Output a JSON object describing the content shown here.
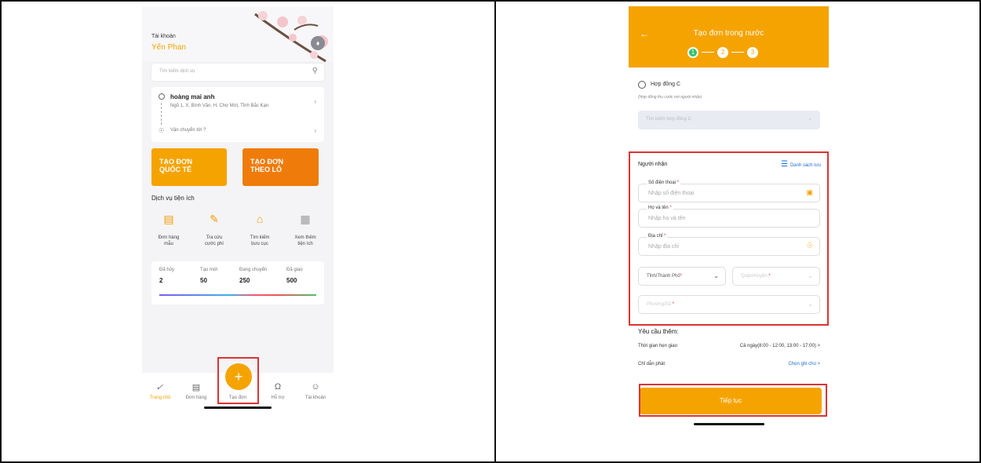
{
  "left": {
    "account": {
      "label": "Tài khoản",
      "name": "Yến Phan"
    },
    "search_placeholder": "Tìm kiếm dịch vụ",
    "address": {
      "sender": "hoàng mai anh",
      "line": "Ngõ 1, X. Bình Văn, H. Chợ Mới, Tỉnh Bắc Kạn",
      "to": "Vận chuyển tới ?"
    },
    "cards": [
      {
        "l1": "TẠO ĐƠN",
        "l2": "QUỐC TẾ"
      },
      {
        "l1": "TẠO ĐƠN",
        "l2": "THEO LÔ"
      }
    ],
    "section_title": "Dịch vụ tiện ích",
    "utilities": [
      {
        "icon": "notebook-icon",
        "l1": "Đơn hàng",
        "l2": "mẫu"
      },
      {
        "icon": "search-fee-icon",
        "l1": "Tra cứu",
        "l2": "cước phí"
      },
      {
        "icon": "post-office-icon",
        "l1": "Tìm kiếm",
        "l2": "bưu cục"
      },
      {
        "icon": "grid-icon",
        "l1": "Xem thêm",
        "l2": "tiện ích"
      }
    ],
    "stats": [
      {
        "k": "Đã hủy",
        "v": "2"
      },
      {
        "k": "Tạo mới",
        "v": "50"
      },
      {
        "k": "Đang chuyển",
        "v": "250"
      },
      {
        "k": "Đã giao",
        "v": "500"
      }
    ],
    "nav": [
      "Trang chủ",
      "Đơn hàng",
      "Tạo đơn",
      "Hỗ trợ",
      "Tài khoản"
    ],
    "fab": "+"
  },
  "right": {
    "title": "Tạo đơn trong nước",
    "steps": [
      "1",
      "2",
      "3"
    ],
    "contract": {
      "label": "Hợp đồng C",
      "sub": "(Hợp đồng thu cước nơi người nhận)",
      "search_placeholder": "Tìm kiếm hợp đồng C"
    },
    "receiver": {
      "title": "Người nhận",
      "saved_list": "Danh sách lưu",
      "phone": {
        "label": "Số điện thoại",
        "placeholder": "Nhập số điện thoại"
      },
      "name": {
        "label": "Họ và tên",
        "placeholder": "Nhập họ và tên"
      },
      "address": {
        "label": "Địa chỉ",
        "placeholder": "Nhập địa chỉ"
      },
      "province": "Tỉnh/Thành Phố",
      "district": "Quận/Huyện",
      "ward": "Phường/Xã"
    },
    "extra": {
      "title": "Yêu cầu thêm:",
      "time_label": "Thời gian hẹn giao",
      "time_value": "Cả ngày(8:00 - 12:00, 13:00 - 17:00) >",
      "note_label": "Chỉ dẫn phát",
      "note_value": "Chọn ghi chú >"
    },
    "continue": "Tiếp tục"
  }
}
